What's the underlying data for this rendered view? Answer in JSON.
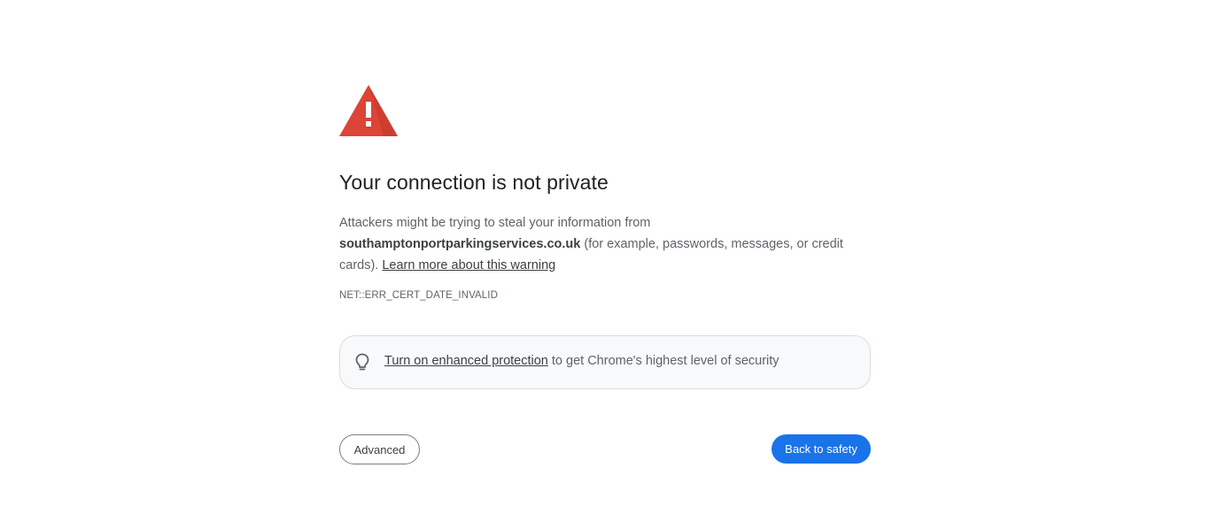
{
  "colors": {
    "warning_red": "#db4437",
    "primary_blue": "#1a73e8",
    "banner_bg": "#f8f9fa",
    "banner_border": "#dadce0"
  },
  "icons": {
    "warning": "warning-triangle-icon",
    "tip": "lightbulb-icon"
  },
  "main": {
    "title": "Your connection is not private",
    "description": {
      "before": "Attackers might be trying to steal your information from ",
      "hostname": "southamptonportparkingservices.co.uk",
      "after": " (for example, passwords, messages, or credit cards). ",
      "learn_more": "Learn more about this warning"
    },
    "error_code": "NET::ERR_CERT_DATE_INVALID"
  },
  "banner": {
    "link": "Turn on enhanced protection",
    "text": " to get Chrome's highest level of security"
  },
  "buttons": {
    "advanced": "Advanced",
    "back_to_safety": "Back to safety"
  }
}
